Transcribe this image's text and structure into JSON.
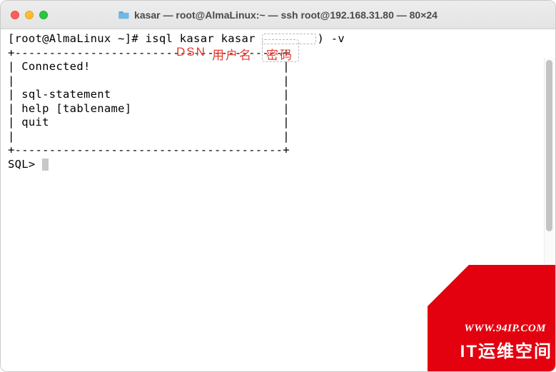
{
  "window": {
    "title": "kasar — root@AlmaLinux:~ — ssh root@192.168.31.80 — 80×24"
  },
  "terminal": {
    "prompt_line": "[root@AlmaLinux ~]# isql kasar kasar ",
    "prompt_tail": ") -v",
    "box_top": "+---------------------------------------+",
    "line_connected": "| Connected!                            |",
    "line_blank": "|                                       |",
    "line_sql": "| sql-statement                         |",
    "line_help": "| help [tablename]                      |",
    "line_quit": "| quit                                  |",
    "box_bot": "+---------------------------------------+",
    "sql_prompt": "SQL> "
  },
  "annotations": {
    "dsn": "DSN",
    "user": "用户名",
    "pass": "密码"
  },
  "watermark": {
    "url": "WWW.94IP.COM",
    "cn": "IT运维空间"
  }
}
